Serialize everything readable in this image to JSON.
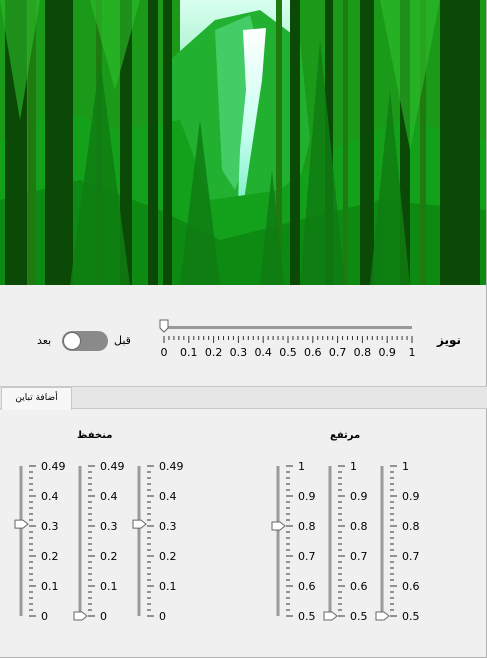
{
  "image": {
    "description_icon": "forest-waterfall-image"
  },
  "noise": {
    "label": "نويز",
    "value": 0,
    "min": 0,
    "max": 1,
    "ticks": [
      "0",
      "0.1",
      "0.2",
      "0.3",
      "0.4",
      "0.5",
      "0.6",
      "0.7",
      "0.8",
      "0.9",
      "1"
    ]
  },
  "toggle": {
    "before_label": "قبل",
    "after_label": "بعد",
    "state": "off"
  },
  "tabs": [
    {
      "label": "أضافة تباين",
      "selected": true
    }
  ],
  "low_group": {
    "title": "منخفظ",
    "ticks": [
      "0.49",
      "0.4",
      "0.3",
      "0.2",
      "0.1",
      "0"
    ],
    "min": 0,
    "max": 0.49,
    "values": [
      0.3,
      0,
      0.3
    ]
  },
  "high_group": {
    "title": "مرتفع",
    "ticks": [
      "1",
      "0.9",
      "0.8",
      "0.7",
      "0.6",
      "0.5"
    ],
    "min": 0.5,
    "max": 1,
    "values": [
      0.8,
      0.5,
      0.5
    ]
  },
  "colors": {
    "track": "#9a9a9a",
    "toggle_off": "#8a8a8a",
    "forest": "#0b8a10"
  }
}
